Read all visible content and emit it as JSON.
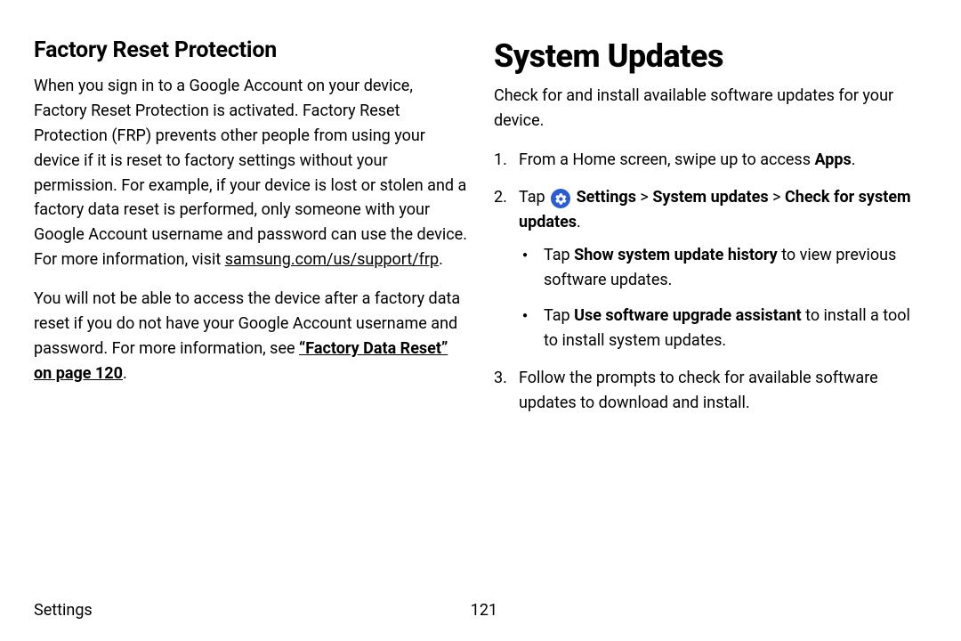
{
  "left": {
    "heading": "Factory Reset Protection",
    "p1a": "When you sign in to a Google Account on your device, Factory Reset Protection is activated. Factory Reset Protection (FRP) prevents other people from using your device if it is reset to factory settings without your permission. For example, if your device is lost or stolen and a factory data reset is performed, only someone with your Google Account username and password can use the device. For more information, visit ",
    "p1_link": "samsung.com/us/support/frp",
    "p1b": ".",
    "p2a": "You will not be able to access the device after a factory data reset if you do not have your Google Account username and password. For more information, see ",
    "p2_link": "“Factory Data Reset” on page 120",
    "p2b": "."
  },
  "right": {
    "heading": "System Updates",
    "intro": "Check for and install available software updates for your device.",
    "step1a": "From a Home screen, swipe up to access ",
    "step1b": "Apps",
    "step1c": ".",
    "step2a": "Tap ",
    "step2_b1": "Settings",
    "step2_sep1": " > ",
    "step2_b2": "System updates",
    "step2_sep2": " > ",
    "step2_b3": "Check for system updates",
    "step2c": ".",
    "sub1a": "Tap ",
    "sub1b": "Show system update history",
    "sub1c": " to view previous software updates.",
    "sub2a": "Tap ",
    "sub2b": "Use software upgrade assistant",
    "sub2c": " to install a tool to install system updates.",
    "step3": "Follow the prompts to check for available software updates to download and install."
  },
  "footer": {
    "label": "Settings",
    "page": "121"
  }
}
